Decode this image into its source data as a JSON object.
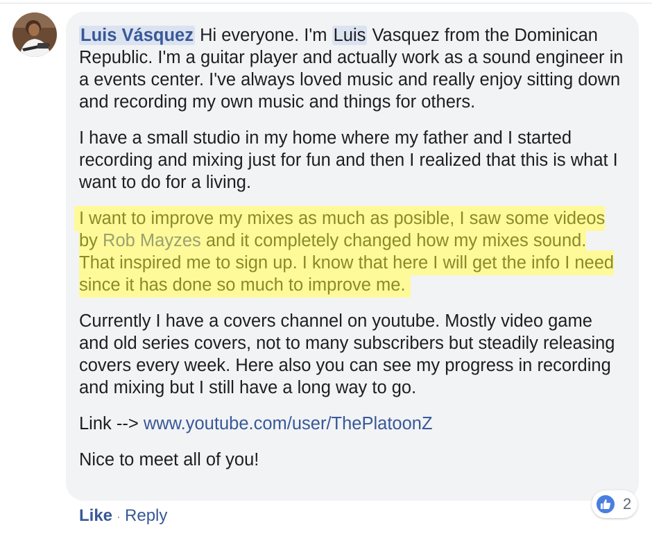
{
  "comment": {
    "author": "Luis Vásquez",
    "p1_mention": "Luis",
    "p1_a": "Hi everyone. I'm ",
    "p1_b": " Vasquez from the Dominican Republic. I'm a guitar player and actually work as a sound engineer in a events center. I've always loved music and really enjoy sitting down and recording my own music and things for others.",
    "p2": "I have a small studio in my home where my father and I started recording and mixing just for fun and then I realized that this is what I want to do for a living.",
    "p3_a": "I want to improve my mixes as much as posible, I saw some videos by ",
    "p3_mention": "Rob Mayzes",
    "p3_b": " and it completely changed how my mixes sound. That inspired me to sign up. I know that here I will get the info I need since it has done so much to improve me.",
    "p4": "Currently I have a covers channel on youtube. Mostly video game and old series covers, not to many subscribers but steadily releasing covers every week. Here also you can see my progress in recording and mixing but I still have a long way to go.",
    "p5_label": "Link --> ",
    "p5_link": "www.youtube.com/user/ThePlatoonZ",
    "p6": "Nice to meet all of you!"
  },
  "actions": {
    "like": "Like",
    "separator": "·",
    "reply": "Reply"
  },
  "reactions": {
    "icon": "thumbs-up-icon",
    "count": "2",
    "color": "#4a7fe0"
  }
}
